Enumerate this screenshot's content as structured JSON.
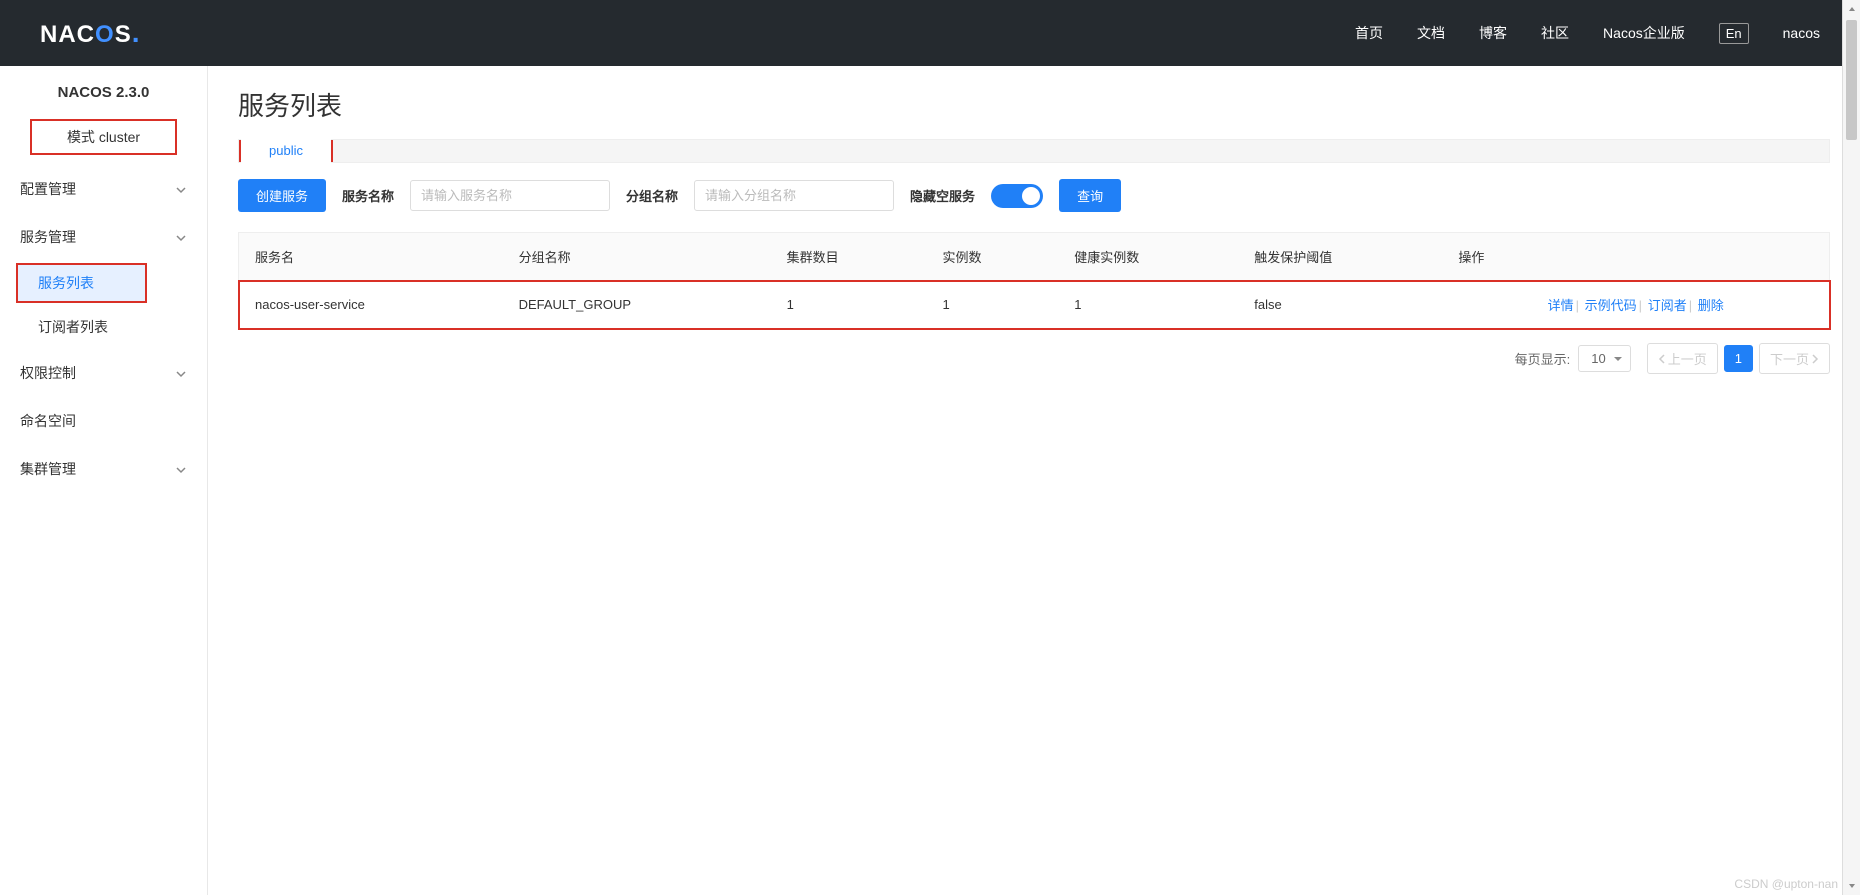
{
  "header": {
    "logo": "NACOS.",
    "nav": [
      "首页",
      "文档",
      "博客",
      "社区",
      "Nacos企业版"
    ],
    "lang": "En",
    "user": "nacos"
  },
  "sidebar": {
    "title": "NACOS 2.3.0",
    "mode": "模式 cluster",
    "items": [
      {
        "label": "配置管理",
        "expandable": true
      },
      {
        "label": "服务管理",
        "expandable": true,
        "expanded": true,
        "children": [
          {
            "label": "服务列表",
            "active": true
          },
          {
            "label": "订阅者列表"
          }
        ]
      },
      {
        "label": "权限控制",
        "expandable": true
      },
      {
        "label": "命名空间"
      },
      {
        "label": "集群管理",
        "expandable": true
      }
    ]
  },
  "main": {
    "title": "服务列表",
    "tabs": [
      {
        "label": "public",
        "active": true
      }
    ],
    "toolbar": {
      "create": "创建服务",
      "service_label": "服务名称",
      "service_placeholder": "请输入服务名称",
      "group_label": "分组名称",
      "group_placeholder": "请输入分组名称",
      "hide_empty_label": "隐藏空服务",
      "hide_empty": true,
      "query": "查询"
    },
    "table": {
      "headers": [
        "服务名",
        "分组名称",
        "集群数目",
        "实例数",
        "健康实例数",
        "触发保护阈值",
        "操作"
      ],
      "rows": [
        {
          "service": "nacos-user-service",
          "group": "DEFAULT_GROUP",
          "clusters": "1",
          "instances": "1",
          "healthy": "1",
          "threshold": "false"
        }
      ],
      "actions": [
        "详情",
        "示例代码",
        "订阅者",
        "删除"
      ]
    },
    "pagination": {
      "per_page_label": "每页显示:",
      "per_page": "10",
      "prev": "上一页",
      "next": "下一页",
      "current": "1"
    }
  },
  "watermark": "CSDN @upton-nan"
}
